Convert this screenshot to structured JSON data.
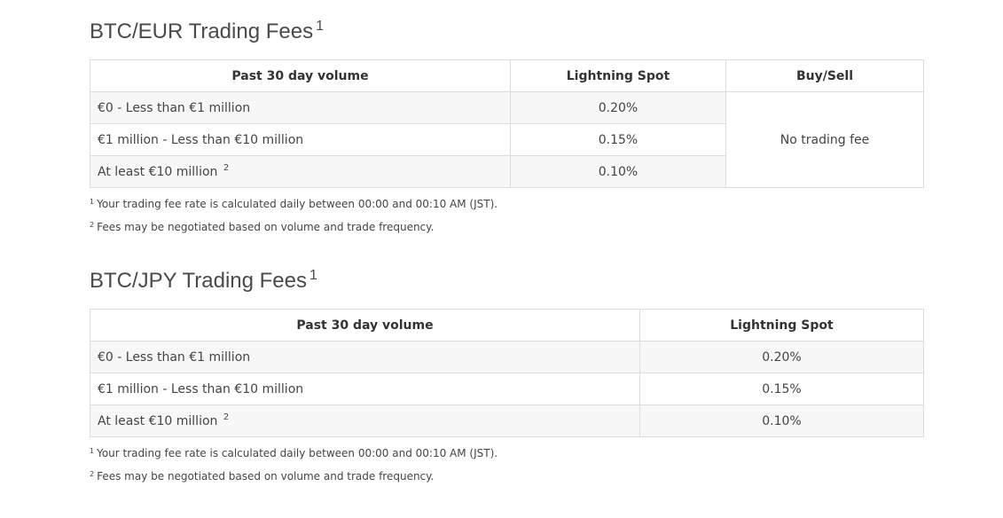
{
  "btc_eur": {
    "title": "BTC/EUR Trading Fees",
    "title_footnote": "1",
    "headers": {
      "volume": "Past 30 day volume",
      "lightning_spot": "Lightning Spot",
      "buy_sell": "Buy/Sell"
    },
    "rows": [
      {
        "volume": "€0 - Less than €1 million",
        "footnote": "",
        "rate": "0.20%"
      },
      {
        "volume": "€1 million - Less than €10 million",
        "footnote": "",
        "rate": "0.15%"
      },
      {
        "volume": "At least €10 million",
        "footnote": "2",
        "rate": "0.10%"
      }
    ],
    "buy_sell_value": "No trading fee",
    "notes": [
      {
        "marker": "1",
        "text": "Your trading fee rate is calculated daily between 00:00 and 00:10 AM (JST)."
      },
      {
        "marker": "2",
        "text": "Fees may be negotiated based on volume and trade frequency."
      }
    ]
  },
  "btc_jpy": {
    "title": "BTC/JPY Trading Fees",
    "title_footnote": "1",
    "headers": {
      "volume": "Past 30 day volume",
      "lightning_spot": "Lightning Spot"
    },
    "rows": [
      {
        "volume": "€0 - Less than €1 million",
        "footnote": "",
        "rate": "0.20%"
      },
      {
        "volume": "€1 million - Less than €10 million",
        "footnote": "",
        "rate": "0.15%"
      },
      {
        "volume": "At least €10 million",
        "footnote": "2",
        "rate": "0.10%"
      }
    ],
    "notes": [
      {
        "marker": "1",
        "text": "Your trading fee rate is calculated daily between 00:00 and 00:10 AM (JST)."
      },
      {
        "marker": "2",
        "text": "Fees may be negotiated based on volume and trade frequency."
      }
    ]
  }
}
